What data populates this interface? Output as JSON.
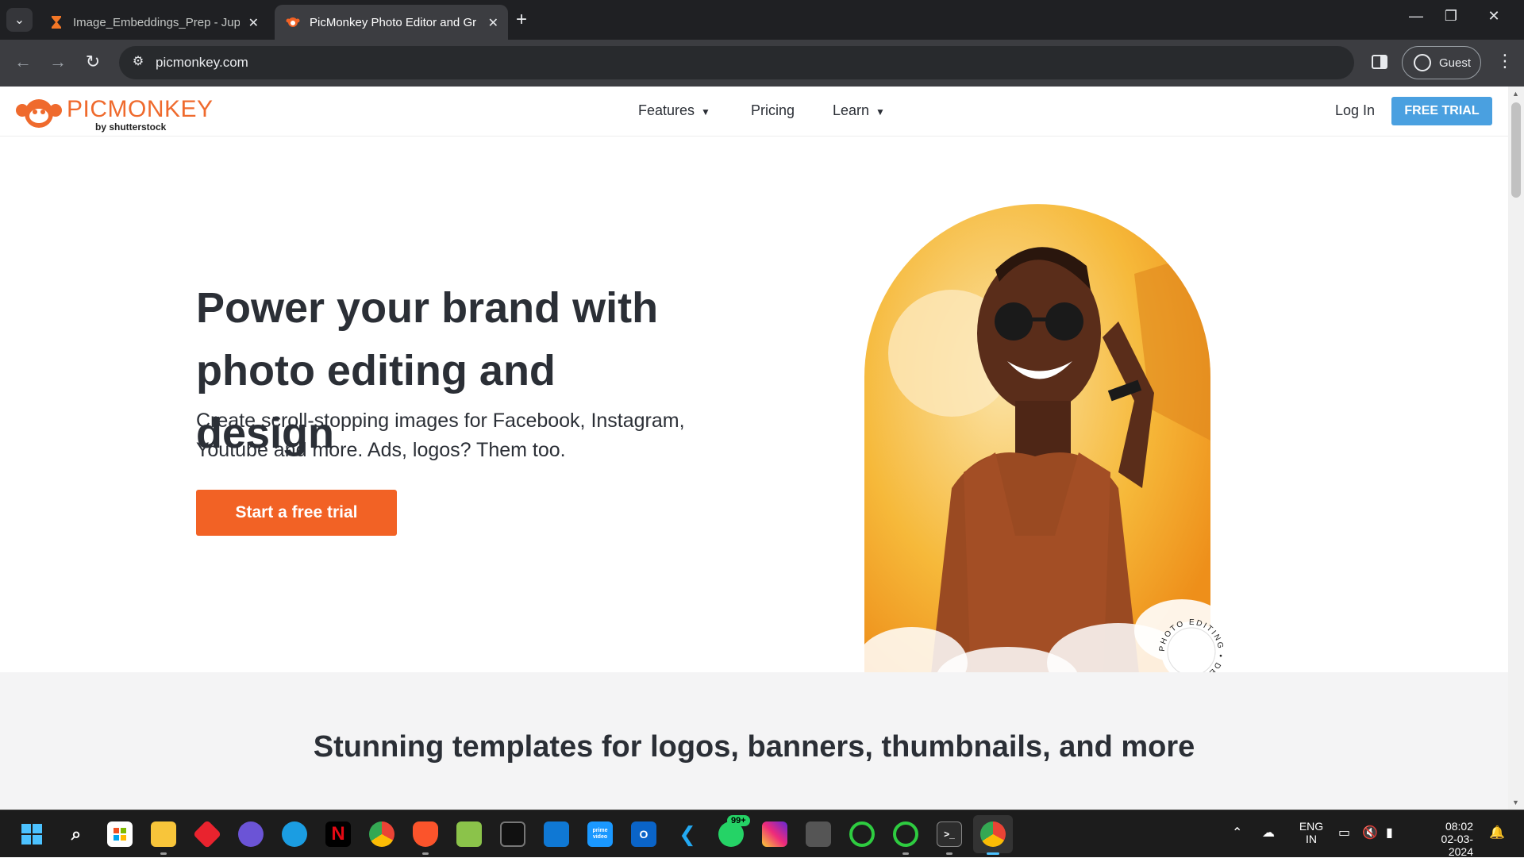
{
  "browser": {
    "tabs": [
      {
        "title": "Image_Embeddings_Prep - Jupyter",
        "icon": "hourglass-icon",
        "active": false
      },
      {
        "title": "PicMonkey Photo Editor and Graphic Design",
        "icon": "picmonkey-icon",
        "active": true
      }
    ],
    "url": "picmonkey.com",
    "profile_label": "Guest",
    "new_tab": "+",
    "close": "✕"
  },
  "site": {
    "logo_word": "PICMONKEY",
    "logo_by": "by shutterstock",
    "nav": [
      {
        "label": "Features",
        "chevron": true
      },
      {
        "label": "Pricing",
        "chevron": false
      },
      {
        "label": "Learn",
        "chevron": true
      }
    ],
    "login_label": "Log In",
    "free_trial_label": "FREE TRIAL",
    "brand_orange": "#f26225",
    "brand_blue": "#4aa0e0"
  },
  "hero": {
    "title": "Power your brand with photo editing and design",
    "subtitle": "Create scroll-stopping images for Facebook, Instagram, Youtube and more. Ads, logos? Them too.",
    "cta_label": "Start a free trial",
    "badge_text": "PHOTO EDITING • DESIGN •"
  },
  "templates": {
    "heading": "Stunning templates for logos, banners, thumbnails, and more"
  },
  "taskbar": {
    "apps": [
      "windows-start-icon",
      "search-icon",
      "store-icon",
      "file-explorer-icon",
      "app-red-icon",
      "copilot-icon",
      "edge-icon",
      "netflix-icon",
      "chrome-icon",
      "brave-icon",
      "photos-icon",
      "terminal-icon",
      "app-blue-icon",
      "prime-video-icon",
      "outlook-icon",
      "vscode-icon",
      "whatsapp-icon",
      "instagram-icon",
      "app-gray-icon",
      "app-green-ring-icon",
      "app-green-ring2-icon",
      "cmd-icon",
      "chrome-active-icon"
    ],
    "whatsapp_badge": "99+",
    "netflix_letter": "N",
    "prime_label": "prime video",
    "lang_top": "ENG",
    "lang_bottom": "IN",
    "time": "08:02",
    "date": "02-03-2024"
  }
}
